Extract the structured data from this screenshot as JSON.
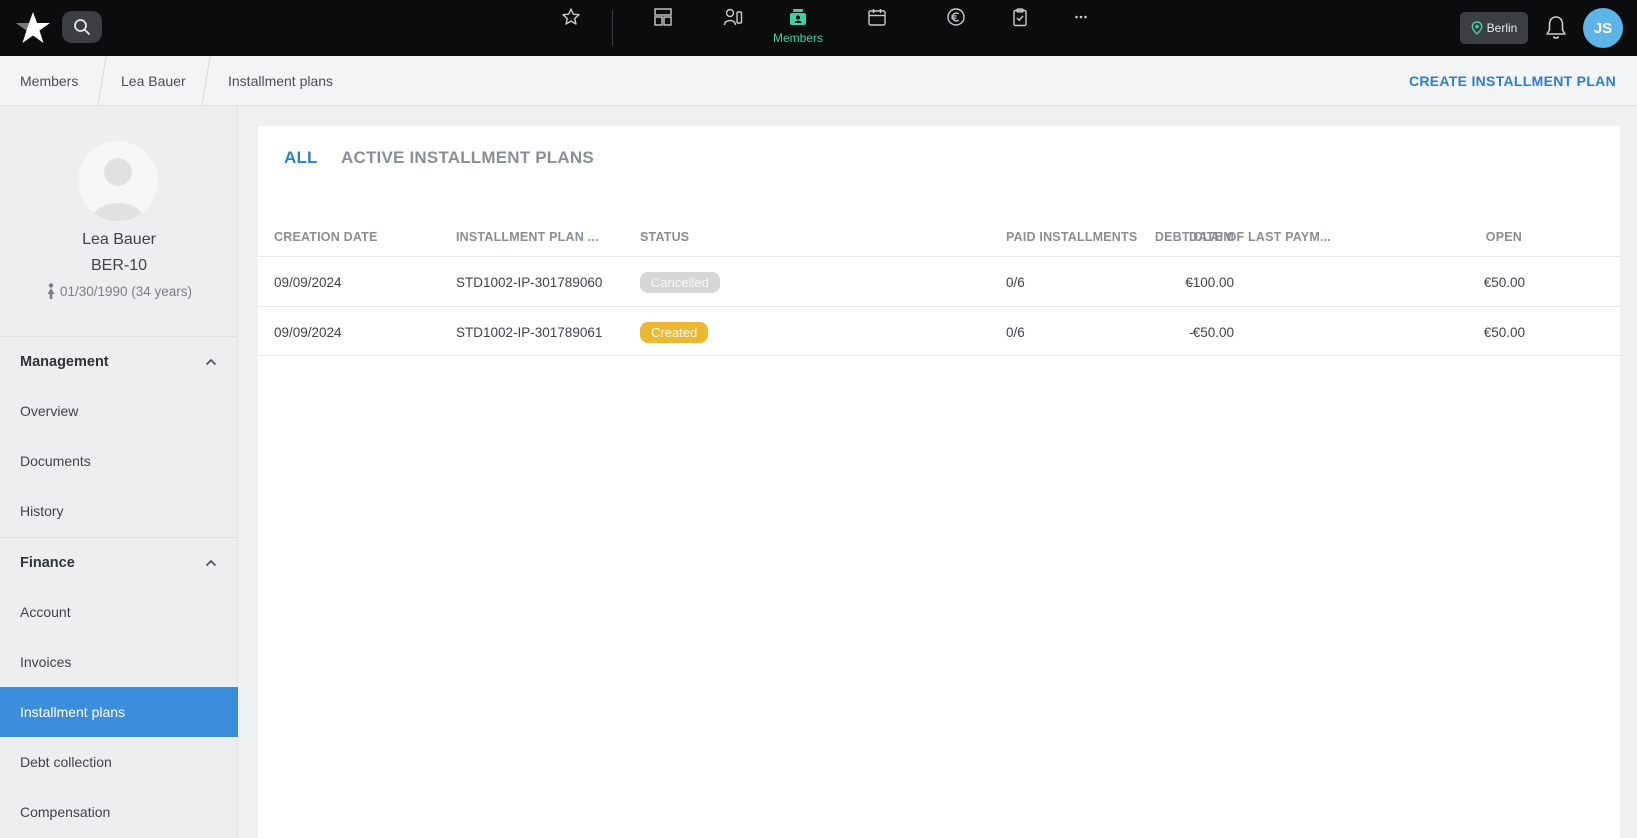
{
  "topnav": {
    "active_label": "Members",
    "location": "Berlin",
    "user_initials": "JS",
    "icons": [
      "star-icon",
      "dashboard-icon",
      "staff-icon",
      "members-icon",
      "calendar-icon",
      "euro-icon",
      "clipboard-icon",
      "more-icon"
    ]
  },
  "breadcrumb": {
    "items": [
      "Members",
      "Lea Bauer",
      "Installment plans"
    ],
    "action": "CREATE INSTALLMENT PLAN"
  },
  "profile": {
    "name": "Lea Bauer",
    "member_id": "BER-10",
    "dob": "01/30/1990 (34 years)"
  },
  "sidebar": {
    "management": {
      "title": "Management",
      "items": [
        "Overview",
        "Documents",
        "History"
      ]
    },
    "finance": {
      "title": "Finance",
      "items": [
        "Account",
        "Invoices",
        "Installment plans",
        "Debt collection",
        "Compensation"
      ]
    }
  },
  "tabs": [
    "ALL",
    "ACTIVE INSTALLMENT PLANS"
  ],
  "table": {
    "headers": [
      "CREATION DATE",
      "INSTALLMENT PLAN ...",
      "STATUS",
      "DEBT CLAIM",
      "PAID INSTALLMENTS",
      "DATE OF LAST PAYM...",
      "OPEN"
    ],
    "rows": [
      {
        "creation_date": "09/09/2024",
        "plan_id": "STD1002-IP-301789060",
        "status": "Cancelled",
        "debt_claim": "€100.00",
        "paid": "0/6",
        "last_payment": "-",
        "open": "€50.00"
      },
      {
        "creation_date": "09/09/2024",
        "plan_id": "STD1002-IP-301789061",
        "status": "Created",
        "debt_claim": "€50.00",
        "paid": "0/6",
        "last_payment": "-",
        "open": "€50.00"
      }
    ]
  },
  "colors": {
    "accent": "#2c7fd0",
    "active_sidebar": "#3d8ddd",
    "nav_active": "#3fd2a0",
    "status_cancelled": "#d4d6d8",
    "status_created": "#ecb832"
  }
}
